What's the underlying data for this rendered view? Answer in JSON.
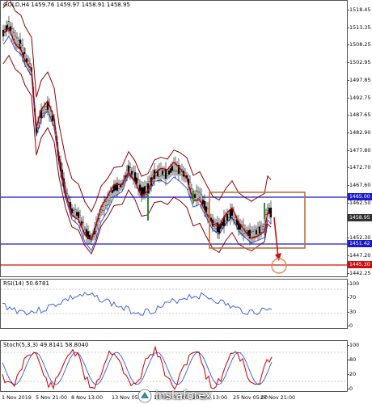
{
  "main_panel": {
    "label": "GOLD,H4  1459.76 1459.97 1458.91 1458.95",
    "price_ticks": [
      "1518.45",
      "1513.35",
      "1508.25",
      "1502.95",
      "1497.85",
      "1492.75",
      "1487.65",
      "1482.90",
      "1477.80",
      "1472.70",
      "1467.60",
      "1462.50",
      "1457.40",
      "1452.30",
      "1447.20",
      "1442.25"
    ],
    "price_tags": [
      {
        "value": "1465.00",
        "color": "#1a1acc"
      },
      {
        "value": "1458.95",
        "color": "#333333"
      },
      {
        "value": "1451.42",
        "color": "#1a1acc"
      },
      {
        "value": "1445.30",
        "color": "#cc1111"
      }
    ],
    "series_colors": {
      "price": "#c00000",
      "ma_fast": "#b00000",
      "ma_slow": "#3355dd",
      "bands": "#8b0000",
      "support": "#1a1acc",
      "resistance": "#1a1acc",
      "target": "#cc1111",
      "box": "#c0703a",
      "bars": "#2e8b2e"
    }
  },
  "rsi_panel": {
    "label": "RSI(14) 50.6781",
    "ticks": [
      "100",
      "70",
      "30",
      "0"
    ],
    "color": "#3355dd"
  },
  "stoch_panel": {
    "label": "Stoch(5,3,3) 49.8141 58.8040",
    "ticks": [
      "100",
      "80",
      "20",
      "0"
    ],
    "colors": {
      "main": "#cc1111",
      "signal": "#3355dd"
    }
  },
  "time_axis": [
    "1 Nov 2019",
    "5 Nov 21:00",
    "8 Nov 13:00",
    "13 Nov 05:00",
    "15 Nov 21:00",
    "20 Nov 13:00",
    "25 Nov 05:00",
    "27 Nov 21:00"
  ],
  "watermark": {
    "text": "instaforex",
    "icon": "instaforex-logo-icon"
  }
}
